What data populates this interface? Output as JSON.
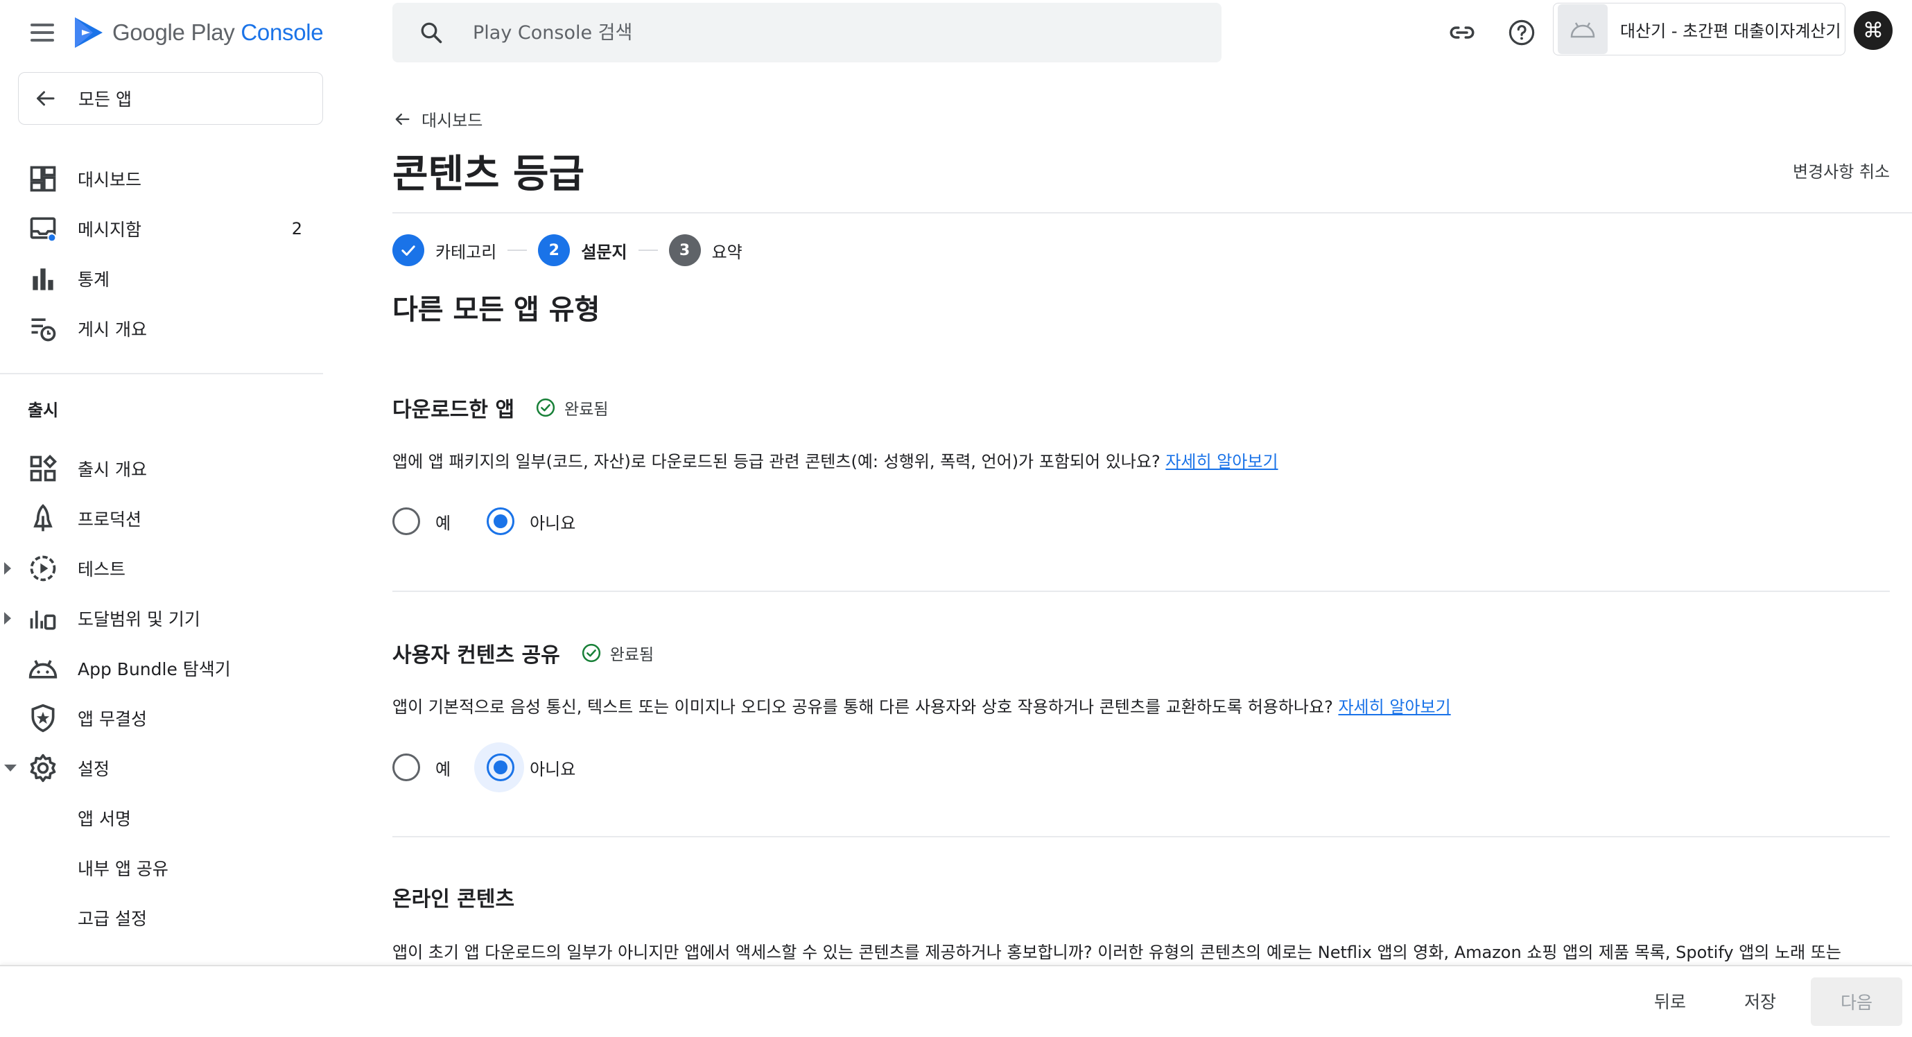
{
  "header": {
    "brand_google_play": "Google Play",
    "brand_console": "Console",
    "search_placeholder": "Play Console 검색",
    "account_name": "대산기 - 초간편 대출이자계산기",
    "avatar_glyph": "⌘"
  },
  "sidebar": {
    "all_apps": "모든 앱",
    "items": [
      {
        "id": "dashboard",
        "label": "대시보드",
        "icon": "dashboard-icon"
      },
      {
        "id": "inbox",
        "label": "메시지함",
        "icon": "inbox-icon",
        "badge": "2"
      },
      {
        "id": "stats",
        "label": "통계",
        "icon": "bar-chart-icon"
      },
      {
        "id": "publishing",
        "label": "게시 개요",
        "icon": "publishing-overview-icon"
      }
    ],
    "release_section": "출시",
    "release_items": [
      {
        "id": "release-overview",
        "label": "출시 개요",
        "icon": "release-overview-icon"
      },
      {
        "id": "production",
        "label": "프로덕션",
        "icon": "production-icon"
      },
      {
        "id": "testing",
        "label": "테스트",
        "icon": "testing-icon"
      },
      {
        "id": "reach",
        "label": "도달범위 및 기기",
        "icon": "reach-devices-icon"
      },
      {
        "id": "bundle",
        "label": "App Bundle 탐색기",
        "icon": "android-icon"
      },
      {
        "id": "integrity",
        "label": "앱 무결성",
        "icon": "shield-icon"
      },
      {
        "id": "setup",
        "label": "설정",
        "icon": "gear-icon"
      }
    ],
    "setup_sub_items": [
      {
        "id": "app-signing",
        "label": "앱 서명"
      },
      {
        "id": "internal-sharing",
        "label": "내부 앱 공유"
      },
      {
        "id": "advanced",
        "label": "고급 설정"
      }
    ]
  },
  "main": {
    "back_label": "대시보드",
    "title": "콘텐츠 등급",
    "discard_label": "변경사항 취소",
    "steps": [
      {
        "num": "",
        "label": "카테고리",
        "state": "done"
      },
      {
        "num": "2",
        "label": "설문지",
        "state": "active"
      },
      {
        "num": "3",
        "label": "요약",
        "state": "pending"
      }
    ],
    "section_heading": "다른 모든 앱 유형",
    "questions": [
      {
        "title": "다운로드한 앱",
        "status": "완료됨",
        "text": "앱에 앱 패키지의 일부(코드, 자산)로 다운로드된 등급 관련 콘텐츠(예: 성행위, 폭력, 언어)가 포함되어 있나요?",
        "link": "자세히 알아보기",
        "yes": "예",
        "no": "아니요",
        "answer": "no"
      },
      {
        "title": "사용자 컨텐츠 공유",
        "status": "완료됨",
        "text": "앱이 기본적으로 음성 통신, 텍스트 또는 이미지나 오디오 공유를 통해 다른 사용자와 상호 작용하거나 콘텐츠를 교환하도록 허용하나요?",
        "link": "자세히 알아보기",
        "yes": "예",
        "no": "아니요",
        "answer": "no"
      },
      {
        "title": "온라인 콘텐츠",
        "text": "앱이 초기 앱 다운로드의 일부가 아니지만 앱에서 액세스할 수 있는 콘텐츠를 제공하거나 홍보합니까? 이러한 유형의 콘텐츠의 예로는 Netflix 앱의 영화, Amazon 쇼핑 앱의 제품 목록, Spotify 앱의 노래 또는"
      }
    ]
  },
  "footer": {
    "back": "뒤로",
    "save": "저장",
    "next": "다음"
  },
  "colors": {
    "accent": "#1a73e8",
    "success": "#188038",
    "text": "#202124",
    "muted": "#5f6368"
  }
}
